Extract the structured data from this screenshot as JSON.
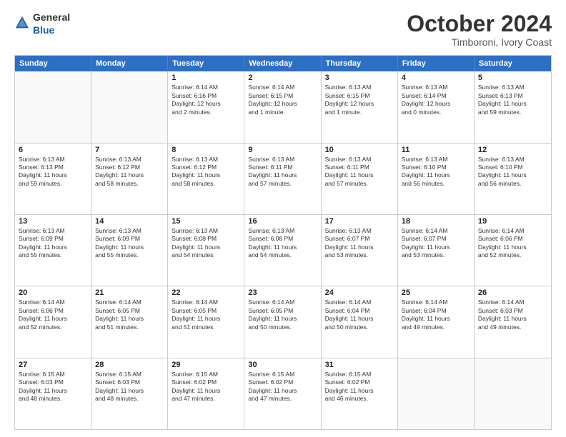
{
  "header": {
    "logo_general": "General",
    "logo_blue": "Blue",
    "month_title": "October 2024",
    "subtitle": "Timboroni, Ivory Coast"
  },
  "days_of_week": [
    "Sunday",
    "Monday",
    "Tuesday",
    "Wednesday",
    "Thursday",
    "Friday",
    "Saturday"
  ],
  "rows": [
    [
      {
        "day": "",
        "lines": []
      },
      {
        "day": "",
        "lines": []
      },
      {
        "day": "1",
        "lines": [
          "Sunrise: 6:14 AM",
          "Sunset: 6:16 PM",
          "Daylight: 12 hours",
          "and 2 minutes."
        ]
      },
      {
        "day": "2",
        "lines": [
          "Sunrise: 6:14 AM",
          "Sunset: 6:15 PM",
          "Daylight: 12 hours",
          "and 1 minute."
        ]
      },
      {
        "day": "3",
        "lines": [
          "Sunrise: 6:13 AM",
          "Sunset: 6:15 PM",
          "Daylight: 12 hours",
          "and 1 minute."
        ]
      },
      {
        "day": "4",
        "lines": [
          "Sunrise: 6:13 AM",
          "Sunset: 6:14 PM",
          "Daylight: 12 hours",
          "and 0 minutes."
        ]
      },
      {
        "day": "5",
        "lines": [
          "Sunrise: 6:13 AM",
          "Sunset: 6:13 PM",
          "Daylight: 11 hours",
          "and 59 minutes."
        ]
      }
    ],
    [
      {
        "day": "6",
        "lines": [
          "Sunrise: 6:13 AM",
          "Sunset: 6:13 PM",
          "Daylight: 11 hours",
          "and 59 minutes."
        ]
      },
      {
        "day": "7",
        "lines": [
          "Sunrise: 6:13 AM",
          "Sunset: 6:12 PM",
          "Daylight: 11 hours",
          "and 58 minutes."
        ]
      },
      {
        "day": "8",
        "lines": [
          "Sunrise: 6:13 AM",
          "Sunset: 6:12 PM",
          "Daylight: 11 hours",
          "and 58 minutes."
        ]
      },
      {
        "day": "9",
        "lines": [
          "Sunrise: 6:13 AM",
          "Sunset: 6:11 PM",
          "Daylight: 11 hours",
          "and 57 minutes."
        ]
      },
      {
        "day": "10",
        "lines": [
          "Sunrise: 6:13 AM",
          "Sunset: 6:11 PM",
          "Daylight: 11 hours",
          "and 57 minutes."
        ]
      },
      {
        "day": "11",
        "lines": [
          "Sunrise: 6:13 AM",
          "Sunset: 6:10 PM",
          "Daylight: 11 hours",
          "and 56 minutes."
        ]
      },
      {
        "day": "12",
        "lines": [
          "Sunrise: 6:13 AM",
          "Sunset: 6:10 PM",
          "Daylight: 11 hours",
          "and 56 minutes."
        ]
      }
    ],
    [
      {
        "day": "13",
        "lines": [
          "Sunrise: 6:13 AM",
          "Sunset: 6:09 PM",
          "Daylight: 11 hours",
          "and 55 minutes."
        ]
      },
      {
        "day": "14",
        "lines": [
          "Sunrise: 6:13 AM",
          "Sunset: 6:09 PM",
          "Daylight: 11 hours",
          "and 55 minutes."
        ]
      },
      {
        "day": "15",
        "lines": [
          "Sunrise: 6:13 AM",
          "Sunset: 6:08 PM",
          "Daylight: 11 hours",
          "and 54 minutes."
        ]
      },
      {
        "day": "16",
        "lines": [
          "Sunrise: 6:13 AM",
          "Sunset: 6:08 PM",
          "Daylight: 11 hours",
          "and 54 minutes."
        ]
      },
      {
        "day": "17",
        "lines": [
          "Sunrise: 6:13 AM",
          "Sunset: 6:07 PM",
          "Daylight: 11 hours",
          "and 53 minutes."
        ]
      },
      {
        "day": "18",
        "lines": [
          "Sunrise: 6:14 AM",
          "Sunset: 6:07 PM",
          "Daylight: 11 hours",
          "and 53 minutes."
        ]
      },
      {
        "day": "19",
        "lines": [
          "Sunrise: 6:14 AM",
          "Sunset: 6:06 PM",
          "Daylight: 11 hours",
          "and 52 minutes."
        ]
      }
    ],
    [
      {
        "day": "20",
        "lines": [
          "Sunrise: 6:14 AM",
          "Sunset: 6:06 PM",
          "Daylight: 11 hours",
          "and 52 minutes."
        ]
      },
      {
        "day": "21",
        "lines": [
          "Sunrise: 6:14 AM",
          "Sunset: 6:05 PM",
          "Daylight: 11 hours",
          "and 51 minutes."
        ]
      },
      {
        "day": "22",
        "lines": [
          "Sunrise: 6:14 AM",
          "Sunset: 6:05 PM",
          "Daylight: 11 hours",
          "and 51 minutes."
        ]
      },
      {
        "day": "23",
        "lines": [
          "Sunrise: 6:14 AM",
          "Sunset: 6:05 PM",
          "Daylight: 11 hours",
          "and 50 minutes."
        ]
      },
      {
        "day": "24",
        "lines": [
          "Sunrise: 6:14 AM",
          "Sunset: 6:04 PM",
          "Daylight: 11 hours",
          "and 50 minutes."
        ]
      },
      {
        "day": "25",
        "lines": [
          "Sunrise: 6:14 AM",
          "Sunset: 6:04 PM",
          "Daylight: 11 hours",
          "and 49 minutes."
        ]
      },
      {
        "day": "26",
        "lines": [
          "Sunrise: 6:14 AM",
          "Sunset: 6:03 PM",
          "Daylight: 11 hours",
          "and 49 minutes."
        ]
      }
    ],
    [
      {
        "day": "27",
        "lines": [
          "Sunrise: 6:15 AM",
          "Sunset: 6:03 PM",
          "Daylight: 11 hours",
          "and 48 minutes."
        ]
      },
      {
        "day": "28",
        "lines": [
          "Sunrise: 6:15 AM",
          "Sunset: 6:03 PM",
          "Daylight: 11 hours",
          "and 48 minutes."
        ]
      },
      {
        "day": "29",
        "lines": [
          "Sunrise: 6:15 AM",
          "Sunset: 6:02 PM",
          "Daylight: 11 hours",
          "and 47 minutes."
        ]
      },
      {
        "day": "30",
        "lines": [
          "Sunrise: 6:15 AM",
          "Sunset: 6:02 PM",
          "Daylight: 11 hours",
          "and 47 minutes."
        ]
      },
      {
        "day": "31",
        "lines": [
          "Sunrise: 6:15 AM",
          "Sunset: 6:02 PM",
          "Daylight: 11 hours",
          "and 46 minutes."
        ]
      },
      {
        "day": "",
        "lines": []
      },
      {
        "day": "",
        "lines": []
      }
    ]
  ]
}
